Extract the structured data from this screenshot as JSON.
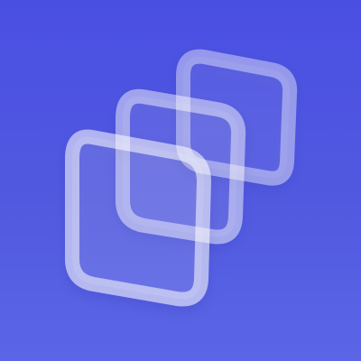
{
  "app_icon": {
    "icon_name": "stacked-squares-icon",
    "colors": {
      "background_top": "#4a4fe2",
      "background_bottom": "#5a66e6",
      "outline_stroke": "#ffffff",
      "outline_fill": "#ffffff"
    }
  }
}
